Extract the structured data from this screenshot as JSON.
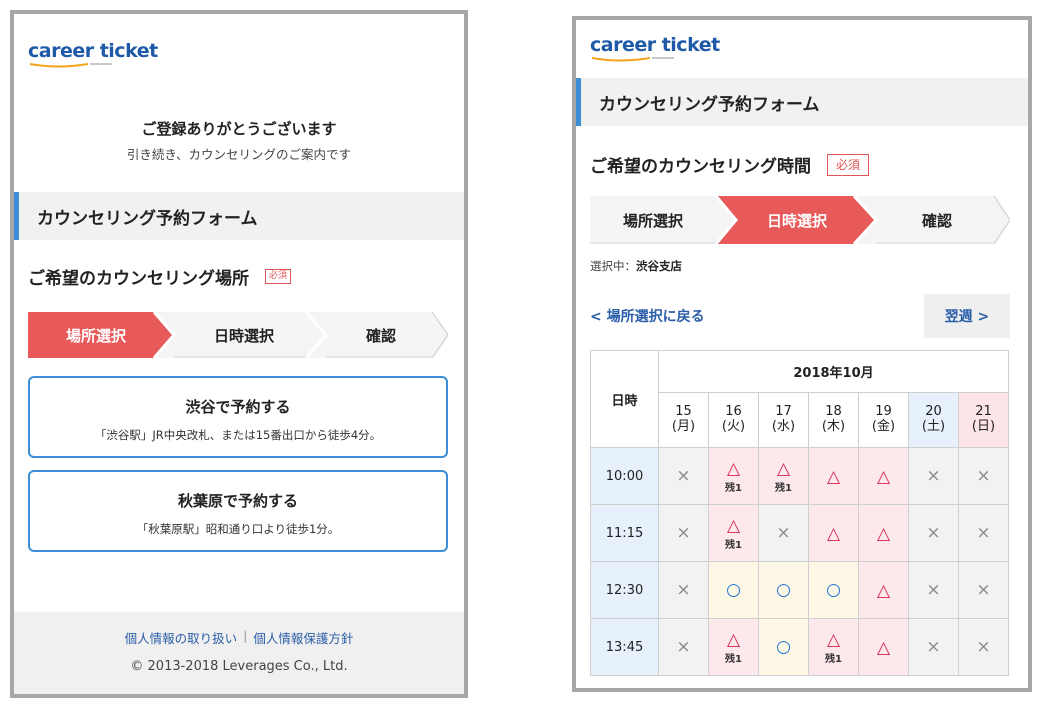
{
  "brand": {
    "logo_text": "career ticket"
  },
  "screen1": {
    "thanks_title": "ご登録ありがとうございます",
    "thanks_sub": "引き続き、カウンセリングのご案内です",
    "section_title": "カウンセリング予約フォーム",
    "heading": "ご希望のカウンセリング場所",
    "required": "必須",
    "steps": [
      "場所選択",
      "日時選択",
      "確認"
    ],
    "places": [
      {
        "title": "渋谷で予約する",
        "desc": "「渋谷駅」JR中央改札、または15番出口から徒歩4分。"
      },
      {
        "title": "秋葉原で予約する",
        "desc": "「秋葉原駅」昭和通り口より徒歩1分。"
      }
    ],
    "footer": {
      "link_privacy_handling": "個人情報の取り扱い",
      "separator": "|",
      "link_privacy_policy": "個人情報保護方針",
      "copyright": "© 2013-2018 Leverages Co., Ltd."
    }
  },
  "screen2": {
    "section_title": "カウンセリング予約フォーム",
    "heading": "ご希望のカウンセリング時間",
    "required": "必須",
    "steps": [
      "場所選択",
      "日時選択",
      "確認"
    ],
    "selected_label": "選択中：",
    "selected_value": "渋谷支店",
    "back_link": "< 場所選択に戻る",
    "next_week": "翌週 >",
    "calendar": {
      "time_header": "日時",
      "month": "2018年10月",
      "days": [
        {
          "date": "15",
          "dow": "(月)"
        },
        {
          "date": "16",
          "dow": "(火)"
        },
        {
          "date": "17",
          "dow": "(水)"
        },
        {
          "date": "18",
          "dow": "(木)"
        },
        {
          "date": "19",
          "dow": "(金)"
        },
        {
          "date": "20",
          "dow": "(土)"
        },
        {
          "date": "21",
          "dow": "(日)"
        }
      ],
      "rows": [
        {
          "time": "10:00",
          "slots": [
            {
              "mark": "×",
              "bg": "gray"
            },
            {
              "mark": "△",
              "note": "残1",
              "bg": "pink"
            },
            {
              "mark": "△",
              "note": "残1",
              "bg": "pink"
            },
            {
              "mark": "△",
              "bg": "pink"
            },
            {
              "mark": "△",
              "bg": "pink"
            },
            {
              "mark": "×",
              "bg": "gray"
            },
            {
              "mark": "×",
              "bg": "gray"
            }
          ]
        },
        {
          "time": "11:15",
          "slots": [
            {
              "mark": "×",
              "bg": "gray"
            },
            {
              "mark": "△",
              "note": "残1",
              "bg": "pink"
            },
            {
              "mark": "×",
              "bg": "gray"
            },
            {
              "mark": "△",
              "bg": "pink"
            },
            {
              "mark": "△",
              "bg": "pink"
            },
            {
              "mark": "×",
              "bg": "gray"
            },
            {
              "mark": "×",
              "bg": "gray"
            }
          ]
        },
        {
          "time": "12:30",
          "slots": [
            {
              "mark": "×",
              "bg": "gray"
            },
            {
              "mark": "○",
              "bg": "yellow"
            },
            {
              "mark": "○",
              "bg": "yellow"
            },
            {
              "mark": "○",
              "bg": "yellow"
            },
            {
              "mark": "△",
              "bg": "pink"
            },
            {
              "mark": "×",
              "bg": "gray"
            },
            {
              "mark": "×",
              "bg": "gray"
            }
          ]
        },
        {
          "time": "13:45",
          "slots": [
            {
              "mark": "×",
              "bg": "gray"
            },
            {
              "mark": "△",
              "note": "残1",
              "bg": "pink"
            },
            {
              "mark": "○",
              "bg": "yellow"
            },
            {
              "mark": "△",
              "note": "残1",
              "bg": "pink"
            },
            {
              "mark": "△",
              "bg": "pink"
            },
            {
              "mark": "×",
              "bg": "gray"
            },
            {
              "mark": "×",
              "bg": "gray"
            }
          ]
        }
      ]
    }
  },
  "colors": {
    "accent_red": "#e85a5a",
    "accent_blue": "#3a8fd6",
    "link_blue": "#2b5ea8",
    "triangle_red": "#d6244a",
    "circle_blue": "#1e72d1"
  }
}
